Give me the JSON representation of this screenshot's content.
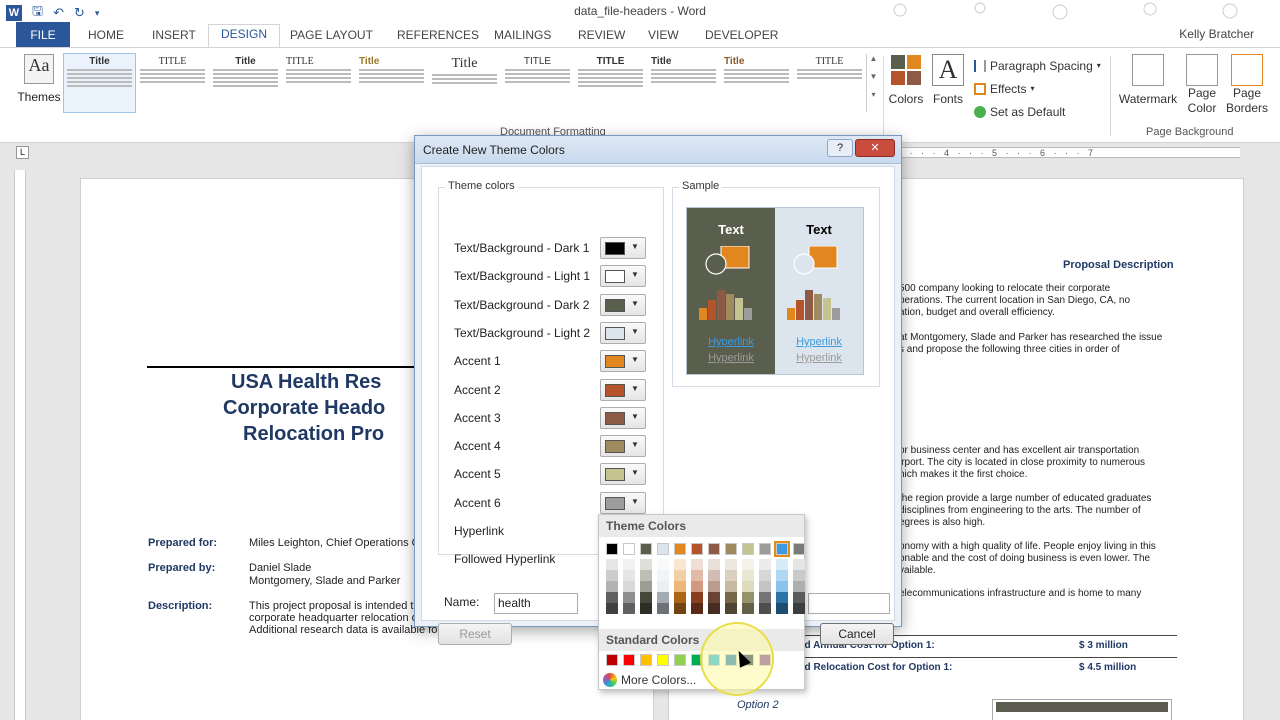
{
  "window": {
    "title": "data_file-headers - Word",
    "user": "Kelly Bratcher"
  },
  "tabs": [
    "FILE",
    "HOME",
    "INSERT",
    "DESIGN",
    "PAGE LAYOUT",
    "REFERENCES",
    "MAILINGS",
    "REVIEW",
    "VIEW",
    "DEVELOPER"
  ],
  "ribbon": {
    "themes_label": "Themes",
    "doc_formatting_label": "Document Formatting",
    "style_set_titles": [
      "Title",
      "TITLE",
      "Title",
      "TITLE",
      "Title",
      "Title",
      "TITLE",
      "TITLE",
      "Title",
      "Title",
      "TITLE"
    ],
    "colors_label": "Colors",
    "fonts_label": "Fonts",
    "paragraph_spacing": "Paragraph Spacing",
    "effects": "Effects",
    "set_default": "Set as Default",
    "watermark": "Watermark",
    "page_color": "Page Color",
    "page_borders": "Page Borders",
    "page_background_label": "Page Background"
  },
  "ruler": {
    "marks": "3 · · · 4 · · · 5 · · · 6 · · · 7"
  },
  "document": {
    "page1": {
      "title_lines": [
        "USA Health Res",
        "Corporate Heado",
        "Relocation Pro"
      ],
      "prepared_for_label": "Prepared for:",
      "prepared_for_value": "Miles Leighton, Chief Operations Of",
      "prepared_by_label": "Prepared by:",
      "prepared_by_value_1": "Daniel Slade",
      "prepared_by_value_2": "Montgomery, Slade and Parker",
      "description_label": "Description:",
      "description_lines": [
        "This project proposal is intended to g",
        "corporate headquarter relocation op",
        "Additional research data is available for review."
      ]
    },
    "page2": {
      "heading": "Proposal Description",
      "paragraphs": [
        [
          "500 company looking to relocate their corporate",
          "perations. The current location in San Diego, CA, no",
          "ation, budget and overall efficiency."
        ],
        [
          "at Montgomery, Slade and Parker has researched the issue",
          "s and propose the following three cities in order of"
        ],
        [
          "or business center and has excellent air transportation",
          "irport. The city is located in close proximity to numerous",
          "hich makes it the first choice."
        ],
        [
          "the region provide a large number of educated graduates",
          "disciplines from engineering to the arts. The number of",
          "egrees is also high."
        ],
        [
          "onomy with a high quality of life. People enjoy living in this",
          "onable and the cost of doing business is even lower. The",
          "vailable."
        ],
        [
          "elecommunications infrastructure and is home to many"
        ]
      ],
      "table": [
        {
          "label": "ed Annual Cost for Option 1:",
          "amount": "$ 3 million"
        },
        {
          "label": "ed Relocation Cost for Option 1:",
          "amount": "$ 4.5 million"
        }
      ],
      "option2": "Option 2"
    }
  },
  "dialog": {
    "title": "Create New Theme Colors",
    "theme_colors_label": "Theme colors",
    "sample_label": "Sample",
    "rows": [
      {
        "label": "Text/Background - Dark 1",
        "color": "#000000"
      },
      {
        "label": "Text/Background - Light 1",
        "color": "#ffffff"
      },
      {
        "label": "Text/Background - Dark 2",
        "color": "#5a5e4c"
      },
      {
        "label": "Text/Background - Light 2",
        "color": "#dce4ed"
      },
      {
        "label": "Accent 1",
        "color": "#e2871f"
      },
      {
        "label": "Accent 2",
        "color": "#b5532b"
      },
      {
        "label": "Accent 3",
        "color": "#8c5a45"
      },
      {
        "label": "Accent 4",
        "color": "#a08a60"
      },
      {
        "label": "Accent 5",
        "color": "#c5c38f"
      },
      {
        "label": "Accent 6",
        "color": "#9c9c9c"
      },
      {
        "label": "Hyperlink",
        "color": "#3a9be0"
      },
      {
        "label": "Followed Hyperlink",
        "color": ""
      }
    ],
    "sample_text": "Text",
    "sample_hyperlink": "Hyperlink",
    "name_label": "Name:",
    "name_value": "health",
    "reset_label": "Reset",
    "cancel_label": "Cancel"
  },
  "color_menu": {
    "theme_colors_header": "Theme Colors",
    "standard_colors_header": "Standard Colors",
    "more_colors": "More Colors...",
    "theme_top": [
      "#000000",
      "#ffffff",
      "#5a5e4c",
      "#dce4ed",
      "#e2871f",
      "#b5532b",
      "#8c5a45",
      "#a08a60",
      "#c5c38f",
      "#9c9c9c",
      "#3a9be0",
      "#7a7a7a"
    ],
    "standard": [
      "#c00000",
      "#ff0000",
      "#ffc000",
      "#ffff00",
      "#92d050",
      "#00b050",
      "#00b0f0",
      "#0070c0",
      "#002060",
      "#7030a0"
    ]
  }
}
